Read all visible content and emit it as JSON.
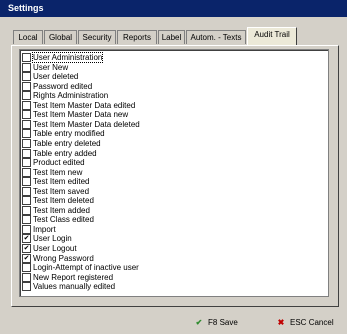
{
  "window": {
    "title": "Settings"
  },
  "tabs": [
    {
      "label": "Local"
    },
    {
      "label": "Global"
    },
    {
      "label": "Security"
    },
    {
      "label": "Reports"
    },
    {
      "label": "Label"
    },
    {
      "label": "Autom. - Texts"
    },
    {
      "label": "Audit Trail"
    }
  ],
  "audit_items": [
    {
      "label": "User Administration",
      "checked": false
    },
    {
      "label": "User New",
      "checked": false
    },
    {
      "label": "User deleted",
      "checked": false
    },
    {
      "label": "Password edited",
      "checked": false
    },
    {
      "label": "Rights Administration",
      "checked": false
    },
    {
      "label": "Test Item Master Data edited",
      "checked": false
    },
    {
      "label": "Test Item Master Data new",
      "checked": false
    },
    {
      "label": "Test Item Master Data deleted",
      "checked": false
    },
    {
      "label": "Table entry modified",
      "checked": false
    },
    {
      "label": "Table entry deleted",
      "checked": false
    },
    {
      "label": "Table entry added",
      "checked": false
    },
    {
      "label": "Product edited",
      "checked": false
    },
    {
      "label": "Test Item new",
      "checked": false
    },
    {
      "label": "Test Item edited",
      "checked": false
    },
    {
      "label": "Test Item saved",
      "checked": false
    },
    {
      "label": "Test Item deleted",
      "checked": false
    },
    {
      "label": "Test Item added",
      "checked": false
    },
    {
      "label": "Test Class edited",
      "checked": false
    },
    {
      "label": "Import",
      "checked": false
    },
    {
      "label": "User Login",
      "checked": true
    },
    {
      "label": "User Logout",
      "checked": true
    },
    {
      "label": "Wrong Password",
      "checked": true
    },
    {
      "label": "Login-Attempt of inactive user",
      "checked": false
    },
    {
      "label": "New Report registered",
      "checked": false
    },
    {
      "label": "Values manually edited",
      "checked": false
    }
  ],
  "buttons": {
    "save": {
      "key": "F8",
      "label": "Save",
      "icon": "check-icon",
      "color": "#2e8b2e"
    },
    "cancel": {
      "key": "ESC",
      "label": "Cancel",
      "icon": "x-icon",
      "color": "#c00000"
    }
  }
}
